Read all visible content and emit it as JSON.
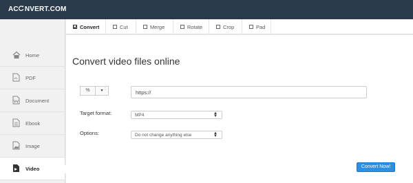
{
  "brand": {
    "logo_prefix": "AC",
    "logo_suffix": "NVERT.COM"
  },
  "sidebar": {
    "items": [
      {
        "label": "Home",
        "icon": "home-icon"
      },
      {
        "label": "PDF",
        "icon": "pdf-icon"
      },
      {
        "label": "Document",
        "icon": "document-icon"
      },
      {
        "label": "Ebook",
        "icon": "ebook-icon"
      },
      {
        "label": "Image",
        "icon": "image-icon"
      },
      {
        "label": "Video",
        "icon": "video-icon",
        "active": true
      }
    ]
  },
  "tabs": [
    {
      "label": "Convert",
      "active": true
    },
    {
      "label": "Cut"
    },
    {
      "label": "Merge"
    },
    {
      "label": "Rotate"
    },
    {
      "label": "Crop"
    },
    {
      "label": "Pad"
    }
  ],
  "main": {
    "title": "Convert video files online",
    "url_input": {
      "value": "https://"
    },
    "source_toggle": {
      "link_glyph": "%",
      "dropdown_glyph": "▾",
      "separator": ":"
    },
    "target_format": {
      "label": "Target format:",
      "value": "MP4"
    },
    "options": {
      "label": "Options:",
      "value": "Do not change anything else"
    },
    "convert_button": "Convert Now!"
  },
  "colors": {
    "topbar": "#2b3a4a",
    "accent": "#2f8fe0"
  }
}
